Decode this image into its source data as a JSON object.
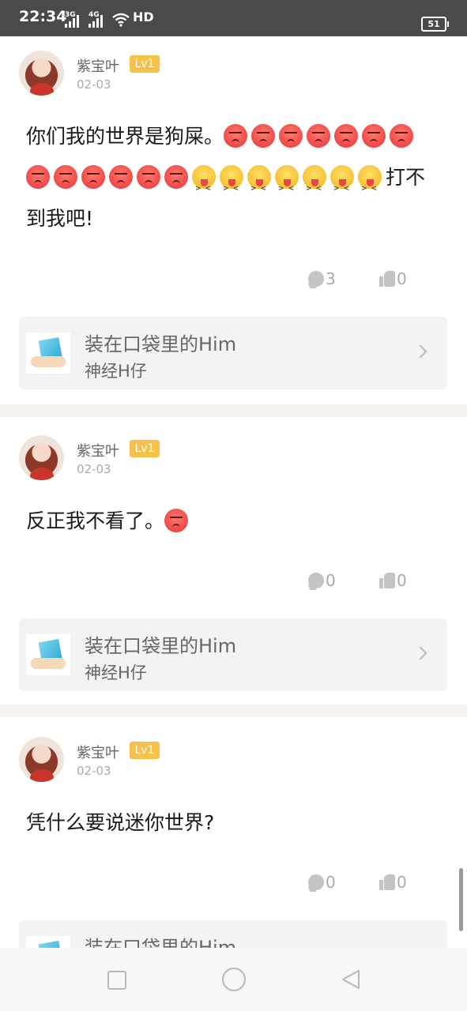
{
  "status_bar": {
    "time": "22:34",
    "network_1": "3G",
    "network_2": "4G",
    "hd": "HD",
    "battery": "51"
  },
  "posts": [
    {
      "username": "紫宝叶",
      "level": "Lv1",
      "date": "02-03",
      "text_before": "你们我的世界是狗屎。",
      "text_after": "打不到我吧!",
      "angry_count": 13,
      "tongue_count": 7,
      "comments": "3",
      "likes": "0",
      "ref_title": "装在口袋里的Him",
      "ref_author": "神经H仔"
    },
    {
      "username": "紫宝叶",
      "level": "Lv1",
      "date": "02-03",
      "text_before": "反正我不看了。",
      "text_after": "",
      "angry_count": 1,
      "tongue_count": 0,
      "comments": "0",
      "likes": "0",
      "ref_title": "装在口袋里的Him",
      "ref_author": "神经H仔"
    },
    {
      "username": "紫宝叶",
      "level": "Lv1",
      "date": "02-03",
      "text_before": "凭什么要说迷你世界?",
      "text_after": "",
      "angry_count": 0,
      "tongue_count": 0,
      "comments": "0",
      "likes": "0",
      "ref_title": "装在口袋里的Him",
      "ref_author": ""
    }
  ],
  "icons": {
    "comment": "comment-bubble-icon",
    "like": "thumbs-up-icon",
    "chevron": "chevron-right-icon",
    "nav_recent": "square-icon",
    "nav_home": "circle-icon",
    "nav_back": "triangle-back-icon"
  },
  "colors": {
    "level_badge": "#f6c14b",
    "card_bg": "#f3f3f3",
    "separator": "#f6f2ee",
    "status_bar": "#4a4a4a"
  }
}
